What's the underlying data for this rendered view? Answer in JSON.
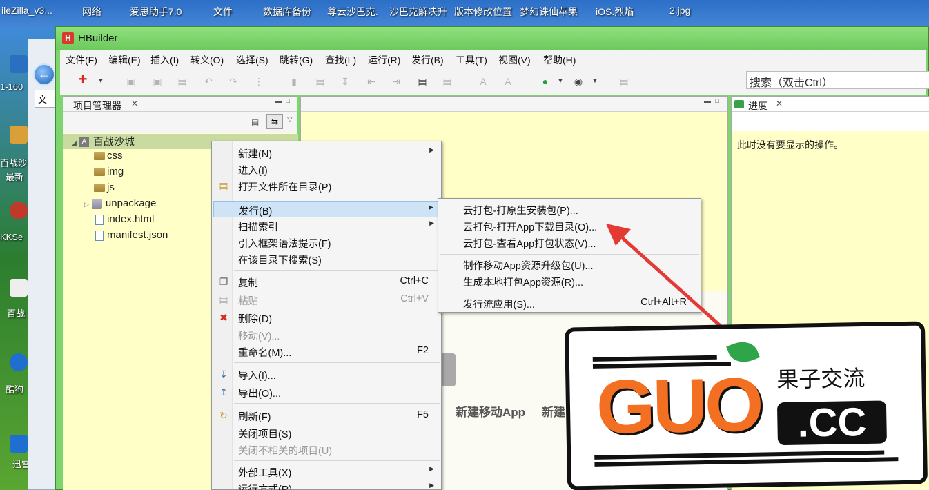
{
  "desktop": {
    "top_labels": [
      "ileZilla_v3...",
      "网络",
      "爱思助手7.0",
      "文件",
      "数据库备份",
      "尊云沙巴克.",
      "沙巴克解决升",
      "版本修改位置",
      "梦幻诛仙苹果",
      "iOS.烈焰",
      "2.jpg"
    ],
    "side_labels": [
      "1-160",
      "百战沙",
      "最新",
      "KKSe",
      "百战",
      "酷狗",
      "迅雷"
    ],
    "back_window_tab": "文件"
  },
  "window": {
    "title": "HBuilder",
    "menu": [
      "文件(F)",
      "编辑(E)",
      "插入(I)",
      "转义(O)",
      "选择(S)",
      "跳转(G)",
      "查找(L)",
      "运行(R)",
      "发行(B)",
      "工具(T)",
      "视图(V)",
      "帮助(H)"
    ],
    "search_placeholder": "搜索（双击Ctrl）"
  },
  "project_panel": {
    "tab": "项目管理器",
    "tree": [
      {
        "label": "百战沙城",
        "type": "project"
      },
      {
        "label": "css",
        "type": "folder"
      },
      {
        "label": "img",
        "type": "folder"
      },
      {
        "label": "js",
        "type": "folder"
      },
      {
        "label": "unpackage",
        "type": "package"
      },
      {
        "label": "index.html",
        "type": "file"
      },
      {
        "label": "manifest.json",
        "type": "file"
      }
    ]
  },
  "progress_panel": {
    "tab": "进度",
    "message": "此时没有要显示的操作。"
  },
  "context_menu": {
    "items": [
      {
        "label": "新建(N)",
        "submenu": true
      },
      {
        "label": "进入(I)"
      },
      {
        "label": "打开文件所在目录(P)",
        "icon": "folder-open-icon"
      },
      {
        "label": "发行(B)",
        "submenu": true,
        "highlighted": true
      },
      {
        "label": "扫描索引",
        "submenu": true
      },
      {
        "label": "引入框架语法提示(F)"
      },
      {
        "label": "在该目录下搜索(S)"
      },
      {
        "label": "复制",
        "shortcut": "Ctrl+C",
        "icon": "copy-icon"
      },
      {
        "label": "粘贴",
        "shortcut": "Ctrl+V",
        "icon": "paste-icon",
        "disabled": true
      },
      {
        "label": "删除(D)",
        "icon": "delete-icon"
      },
      {
        "label": "移动(V)...",
        "disabled": true
      },
      {
        "label": "重命名(M)...",
        "shortcut": "F2"
      },
      {
        "label": "导入(I)...",
        "icon": "import-icon"
      },
      {
        "label": "导出(O)...",
        "icon": "export-icon"
      },
      {
        "label": "刷新(F)",
        "shortcut": "F5",
        "icon": "refresh-icon"
      },
      {
        "label": "关闭项目(S)"
      },
      {
        "label": "关闭不相关的项目(U)",
        "disabled": true
      },
      {
        "label": "外部工具(X)",
        "submenu": true
      },
      {
        "label": "运行方式(R)",
        "submenu": true
      }
    ]
  },
  "publish_submenu": {
    "items": [
      {
        "label": "云打包-打原生安装包(P)..."
      },
      {
        "label": "云打包-打开App下载目录(O)..."
      },
      {
        "label": "云打包-查看App打包状态(V)..."
      },
      {
        "label": "制作移动App资源升级包(U)..."
      },
      {
        "label": "生成本地打包App资源(R)..."
      },
      {
        "label": "发行流应用(S)...",
        "shortcut": "Ctrl+Alt+R"
      }
    ]
  },
  "welcome": {
    "new_app_label": "新建移动App",
    "new_other_label": "新建"
  },
  "watermark": {
    "brand": "GUO",
    "domain": ".CC",
    "slogan": "果子交流"
  },
  "colors": {
    "panel_bg": "#ffffc7",
    "window_green": "#7ed56f",
    "arrow_red": "#e53935",
    "watermark_orange": "#f37023"
  }
}
